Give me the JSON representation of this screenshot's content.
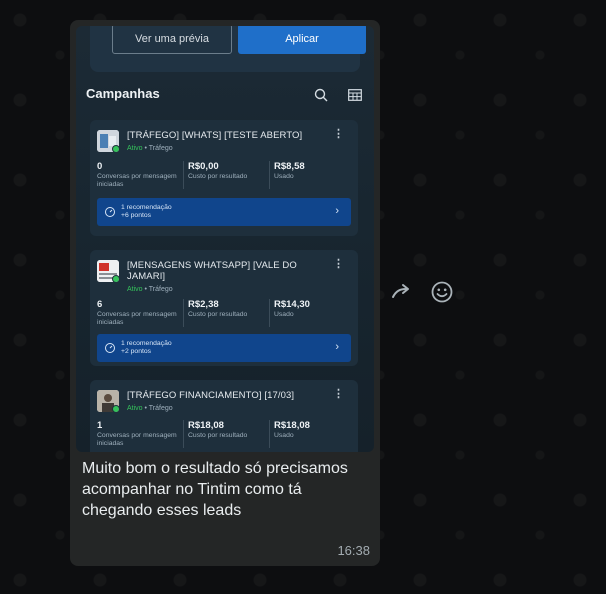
{
  "preview_buttons": {
    "preview_label": "Ver uma prévia",
    "apply_label": "Aplicar"
  },
  "section": {
    "title": "Campanhas",
    "search_icon": "search-icon",
    "table_icon": "table-icon"
  },
  "campaigns": [
    {
      "title": "[TRÁFEGO] [WHATS] [TESTE ABERTO]",
      "status_active": "Ativo",
      "status_type": "Tráfego",
      "results_value": "0",
      "results_label": "Conversas por mensagem iniciadas",
      "cost_value": "R$0,00",
      "cost_label": "Custo por resultado",
      "spent_value": "R$8,58",
      "spent_label": "Usado",
      "rec_title": "1 recomendação",
      "rec_points": "+6 pontos"
    },
    {
      "title": "[MENSAGENS WHATSAPP] [VALE DO JAMARI]",
      "status_active": "Ativo",
      "status_type": "Tráfego",
      "results_value": "6",
      "results_label": "Conversas por mensagem iniciadas",
      "cost_value": "R$2,38",
      "cost_label": "Custo por resultado",
      "spent_value": "R$14,30",
      "spent_label": "Usado",
      "rec_title": "1 recomendação",
      "rec_points": "+2 pontos"
    },
    {
      "title": "[TRÁFEGO FINANCIAMENTO] [17/03]",
      "status_active": "Ativo",
      "status_type": "Tráfego",
      "results_value": "1",
      "results_label": "Conversas por mensagem iniciadas",
      "cost_value": "R$18,08",
      "cost_label": "Custo por resultado",
      "spent_value": "R$18,08",
      "spent_label": "Usado"
    }
  ],
  "message": {
    "text": "Muito bom o resultado só precisamos acompanhar no Tintim como tá chegando esses leads",
    "time": "16:38"
  },
  "icons": {
    "forward": "forward-icon",
    "emoji": "emoji-icon"
  },
  "colors": {
    "bubble": "#242626",
    "apply_button": "#1f6fc9",
    "recommendation": "#10458c",
    "active_status": "#35c35b"
  }
}
